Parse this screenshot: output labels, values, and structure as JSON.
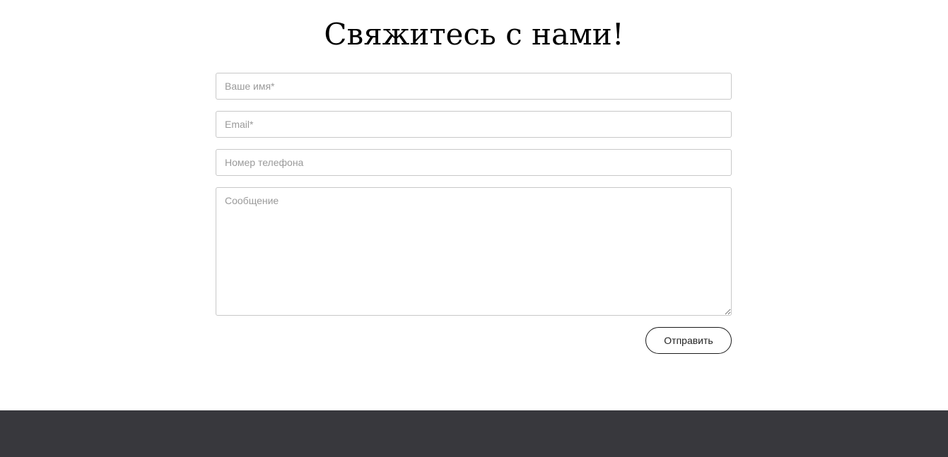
{
  "contact": {
    "title": "Свяжитесь с нами!",
    "fields": {
      "name_placeholder": "Ваше имя*",
      "email_placeholder": "Email*",
      "phone_placeholder": "Номер телефона",
      "message_placeholder": "Сообщение"
    },
    "submit_label": "Отправить"
  },
  "colors": {
    "footer_background": "#38383d",
    "input_border": "#c8c8c8",
    "button_border": "#1a1a1a"
  }
}
